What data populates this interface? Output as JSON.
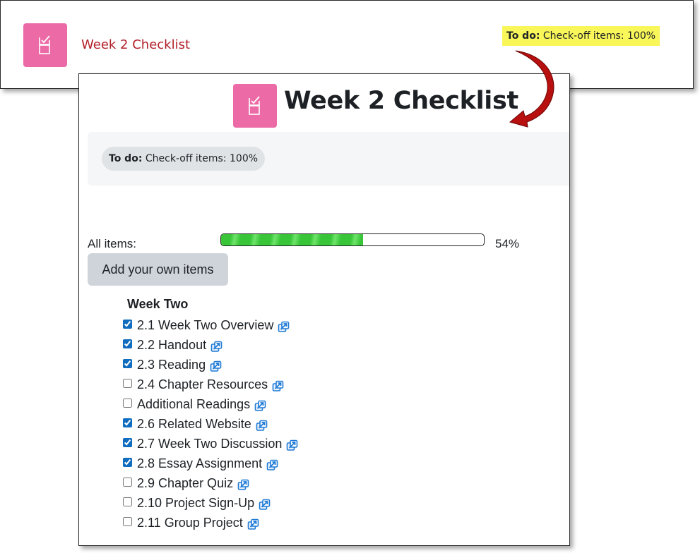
{
  "activity_link": {
    "title": "Week 2 Checklist"
  },
  "todo": {
    "label": "To do:",
    "text": "Check-off items: 100%"
  },
  "page": {
    "title": "Week 2 Checklist"
  },
  "progress": {
    "label": "All items:",
    "percent_text": "54%",
    "value": 54
  },
  "add_button": {
    "label": "Add your own items"
  },
  "section": {
    "heading": "Week Two"
  },
  "items": [
    {
      "label": "2.1 Week Two Overview",
      "checked": true
    },
    {
      "label": "2.2 Handout",
      "checked": true
    },
    {
      "label": "2.3 Reading",
      "checked": true
    },
    {
      "label": "2.4 Chapter Resources",
      "checked": false
    },
    {
      "label": "Additional Readings",
      "checked": false
    },
    {
      "label": "2.6 Related Website",
      "checked": true
    },
    {
      "label": "2.7 Week Two Discussion",
      "checked": true
    },
    {
      "label": "2.8 Essay Assignment",
      "checked": true
    },
    {
      "label": "2.9 Chapter Quiz",
      "checked": false
    },
    {
      "label": "2.10 Project Sign-Up",
      "checked": false
    },
    {
      "label": "2.11 Group Project",
      "checked": false
    }
  ],
  "colors": {
    "icon_bg": "#ec6aa6",
    "link": "#b3202a",
    "highlight": "#f8f659",
    "progress": "#38c638",
    "arrow": "#b80f0f",
    "external_link": "#1f7ad6"
  },
  "icons": {
    "activity": "checklist-icon",
    "external": "external-link-icon",
    "annotation": "curved-arrow"
  }
}
